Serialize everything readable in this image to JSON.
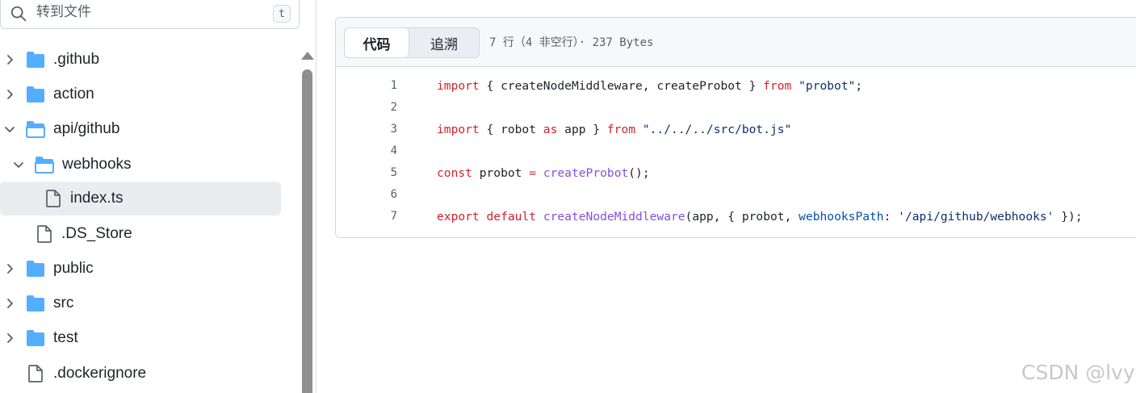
{
  "search": {
    "placeholder": "转到文件",
    "shortcut": "t"
  },
  "tree": [
    {
      "label": ".github",
      "type": "folder",
      "expanded": false
    },
    {
      "label": "action",
      "type": "folder",
      "expanded": false
    },
    {
      "label": "api/github",
      "type": "folder",
      "expanded": true
    },
    {
      "label": "webhooks",
      "type": "folder",
      "expanded": true
    },
    {
      "label": "index.ts",
      "type": "file",
      "selected": true
    },
    {
      "label": ".DS_Store",
      "type": "file"
    },
    {
      "label": "public",
      "type": "folder",
      "expanded": false
    },
    {
      "label": "src",
      "type": "folder",
      "expanded": false
    },
    {
      "label": "test",
      "type": "folder",
      "expanded": false
    },
    {
      "label": ".dockerignore",
      "type": "file"
    }
  ],
  "code_view": {
    "tabs": {
      "code": "代码",
      "blame": "追溯"
    },
    "meta": "7 行（4 非空行）· 237 Bytes",
    "line_numbers": [
      "1",
      "2",
      "3",
      "4",
      "5",
      "6",
      "7"
    ],
    "lines": [
      "import { createNodeMiddleware, createProbot } from \"probot\";",
      "",
      "import { robot as app } from \"../../../src/bot.js\"",
      "",
      "const probot = createProbot();",
      "",
      "export default createNodeMiddleware(app, { probot, webhooksPath: '/api/github/webhooks' });"
    ]
  },
  "watermark": "CSDN @lvy-",
  "colors": {
    "folder": "#54aeff",
    "keyword": "#cf222e",
    "string": "#0a3069",
    "function": "#8250df",
    "property": "#0550ae",
    "selected_bg": "#eaecef"
  }
}
